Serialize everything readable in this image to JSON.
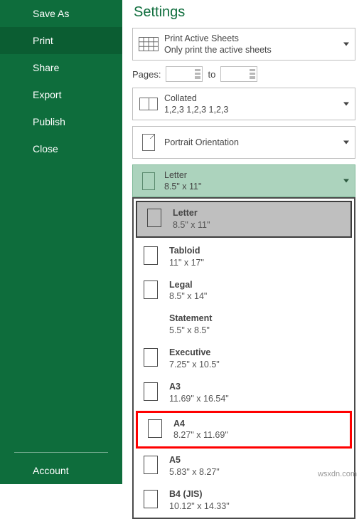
{
  "sidebar": {
    "items": [
      "Save As",
      "Print",
      "Share",
      "Export",
      "Publish",
      "Close"
    ],
    "account": "Account"
  },
  "heading": "Settings",
  "printWhat": {
    "line1": "Print Active Sheets",
    "line2": "Only print the active sheets"
  },
  "pages": {
    "label": "Pages:",
    "to": "to"
  },
  "collated": {
    "line1": "Collated",
    "line2": "1,2,3    1,2,3    1,2,3"
  },
  "orientation": {
    "line1": "Portrait Orientation"
  },
  "pagesize": {
    "line1": "Letter",
    "line2": "8.5\" x 11\""
  },
  "sizes": [
    {
      "name": "Letter",
      "dim": "8.5\" x 11\"",
      "icon": true,
      "selected": true
    },
    {
      "name": "Tabloid",
      "dim": "11\" x 17\"",
      "icon": true
    },
    {
      "name": "Legal",
      "dim": "8.5\" x 14\"",
      "icon": true
    },
    {
      "name": "Statement",
      "dim": "5.5\" x 8.5\"",
      "icon": false
    },
    {
      "name": "Executive",
      "dim": "7.25\" x 10.5\"",
      "icon": true
    },
    {
      "name": "A3",
      "dim": "11.69\" x 16.54\"",
      "icon": true
    },
    {
      "name": "A4",
      "dim": "8.27\" x 11.69\"",
      "icon": true,
      "highlight": true
    },
    {
      "name": "A5",
      "dim": "5.83\" x 8.27\"",
      "icon": true
    },
    {
      "name": "B4 (JIS)",
      "dim": "10.12\" x 14.33\"",
      "icon": true
    }
  ],
  "watermark": "wsxdn.com"
}
